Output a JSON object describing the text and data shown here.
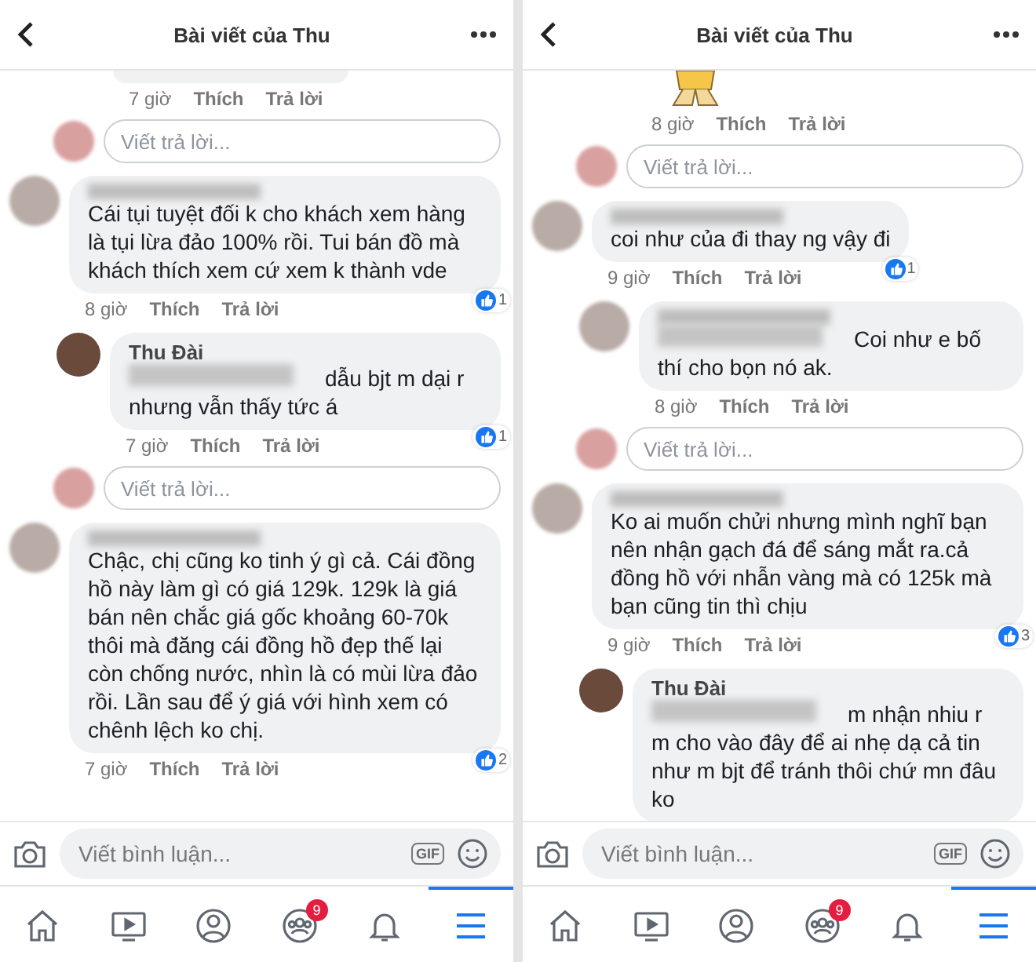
{
  "panels": [
    {
      "header": {
        "title": "Bài viết của Thu"
      },
      "items": [
        {
          "kind": "thread",
          "replies": [
            {
              "kind": "fragment",
              "time": "7 giờ",
              "like": "Thích",
              "reply": "Trả lời"
            }
          ],
          "reply_box": {
            "placeholder": "Viết trả lời..."
          }
        },
        {
          "kind": "comment",
          "name_redacted": true,
          "text": "Cái tụi tuyệt đối k cho khách xem hàng là tụi lừa đảo 100% rồi. Tui bán đồ mà khách thích xem cứ xem k thành vde",
          "time": "8 giờ",
          "like": "Thích",
          "reply": "Trả lời",
          "reactions": "1",
          "replies": [
            {
              "kind": "comment",
              "name": "Thu Đài",
              "lead_redacted": true,
              "text": "dẫu bjt m dại r nhưng vẫn thấy tức á",
              "time": "7 giờ",
              "like": "Thích",
              "reply": "Trả lời",
              "reactions": "1"
            }
          ],
          "reply_box": {
            "placeholder": "Viết trả lời..."
          }
        },
        {
          "kind": "comment",
          "name_redacted": true,
          "text": "Chậc, chị cũng ko tinh ý gì cả. Cái đồng hồ này làm gì có giá 129k. 129k là giá bán nên chắc giá gốc khoảng 60-70k thôi mà đăng cái đồng hồ đẹp thế lại còn chống nước, nhìn là có mùi lừa đảo rồi. Lần sau để ý giá với hình xem có chênh lệch ko chị.",
          "time": "7 giờ",
          "like": "Thích",
          "reply": "Trả lời",
          "reactions": "2"
        }
      ],
      "composer": {
        "placeholder": "Viết bình luận...",
        "gif": "GIF"
      },
      "nav": [
        {
          "selected": false
        },
        {
          "selected": false
        },
        {
          "selected": false
        },
        {
          "selected": false,
          "badge": "9"
        },
        {
          "selected": false
        },
        {
          "selected": true
        }
      ]
    },
    {
      "header": {
        "title": "Bài viết của Thu"
      },
      "items": [
        {
          "kind": "thread",
          "replies": [
            {
              "kind": "sticker",
              "time": "8 giờ",
              "like": "Thích",
              "reply": "Trả lời"
            }
          ],
          "reply_box": {
            "placeholder": "Viết trả lời..."
          }
        },
        {
          "kind": "comment",
          "name_redacted": true,
          "text": "coi như của đi thay ng vậy đi",
          "time": "9 giờ",
          "like": "Thích",
          "reply": "Trả lời",
          "reactions": "1",
          "replies": [
            {
              "kind": "comment",
              "name_redacted": true,
              "lead_redacted": true,
              "text": "Coi như e bố thí cho bọn nó ak.",
              "time": "8 giờ",
              "like": "Thích",
              "reply": "Trả lời"
            }
          ],
          "reply_box": {
            "placeholder": "Viết trả lời..."
          }
        },
        {
          "kind": "comment",
          "name_redacted": true,
          "text": "Ko ai muốn chửi nhưng mình nghĩ bạn nên nhận gạch đá để sáng mắt ra.cả đồng hồ với nhẫn vàng mà có 125k mà bạn cũng tin thì chịu",
          "time": "9 giờ",
          "like": "Thích",
          "reply": "Trả lời",
          "reactions": "3",
          "replies": [
            {
              "kind": "comment",
              "name": "Thu Đài",
              "lead_redacted": true,
              "text": "m nhận nhiu r m cho vào đây để ai nhẹ dạ cả tin như m bjt để tránh thôi chứ mn đâu ko"
            }
          ]
        }
      ],
      "composer": {
        "placeholder": "Viết bình luận...",
        "gif": "GIF"
      },
      "nav": [
        {
          "selected": false
        },
        {
          "selected": false
        },
        {
          "selected": false
        },
        {
          "selected": false,
          "badge": "9"
        },
        {
          "selected": false
        },
        {
          "selected": true
        }
      ]
    }
  ]
}
